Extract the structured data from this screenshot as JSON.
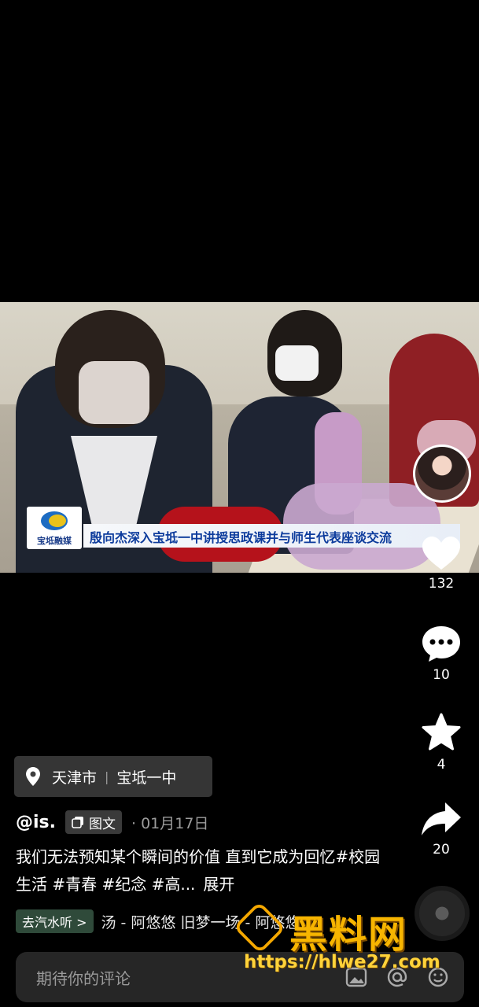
{
  "video": {
    "news_logo_text": "宝坻融媒",
    "news_headline": "殷向杰深入宝坻一中讲授思政课并与师生代表座谈交流"
  },
  "rail": {
    "likes": "132",
    "comments": "10",
    "favorites": "4",
    "shares": "20"
  },
  "location": {
    "city": "天津市",
    "place": "宝坻一中"
  },
  "post": {
    "author": "@is.",
    "type_label": "图文",
    "date": "· 01月17日",
    "description": "我们无法预知某个瞬间的价值 直到它成为回忆#校园生活 #青春 #纪念 #高...",
    "expand_label": "展开"
  },
  "music": {
    "chip_label": "去汽水听 >",
    "track": "汤 - 阿悠悠    旧梦一场 - 阿悠悠"
  },
  "comment_input": {
    "placeholder": "期待你的评论"
  },
  "watermark": {
    "title": "黑料网",
    "url": "https://hlwe27.com"
  },
  "colors": {
    "background": "#000000",
    "comment_bar": "#262626",
    "location_chip": "#3e3e3e",
    "music_chip": "#2f4a3a",
    "watermark_gold": "#f7b500",
    "news_blue": "#0c3b9c"
  }
}
